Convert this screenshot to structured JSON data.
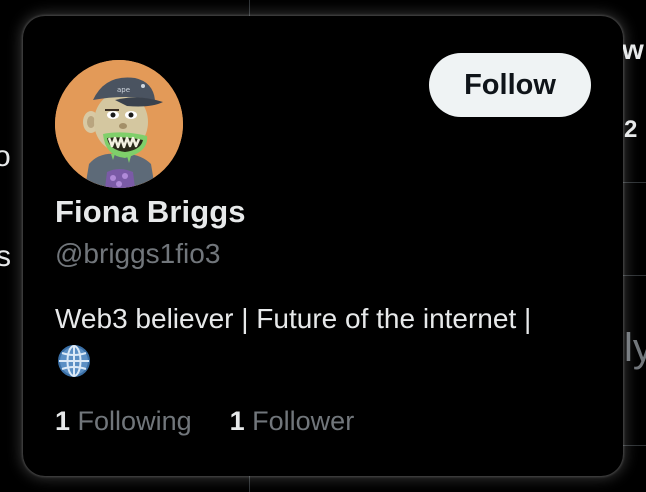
{
  "background": {
    "left_fragments": [
      "o",
      "s"
    ],
    "right_fragments": [
      "w",
      "2",
      "ly"
    ]
  },
  "profile_card": {
    "follow_label": "Follow",
    "display_name": "Fiona Briggs",
    "handle": "@briggs1fio3",
    "bio": "Web3 believer | Future of the internet |",
    "bio_emoji": "globe-with-meridians",
    "following_count": "1",
    "following_label": "Following",
    "followers_count": "1",
    "followers_label": "Follower"
  },
  "colors": {
    "background": "#000000",
    "primary_text": "#e7e9ea",
    "secondary_text": "#71767b",
    "button_bg": "#eff3f4",
    "button_text": "#0f1419",
    "avatar_bg": "#e39a58"
  }
}
